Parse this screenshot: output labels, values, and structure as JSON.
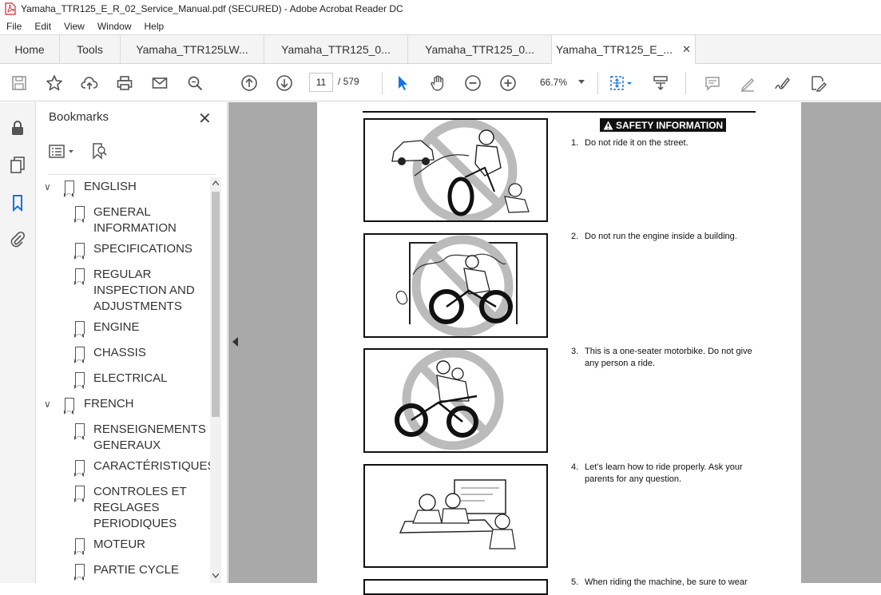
{
  "window": {
    "title": "Yamaha_TTR125_E_R_02_Service_Manual.pdf (SECURED) - Adobe Acrobat Reader DC"
  },
  "menu": [
    "File",
    "Edit",
    "View",
    "Window",
    "Help"
  ],
  "tabs": {
    "home": "Home",
    "tools": "Tools",
    "docs": [
      "Yamaha_TTR125LW...",
      "Yamaha_TTR125_0...",
      "Yamaha_TTR125_0...",
      "Yamaha_TTR125_E_..."
    ],
    "close_glyph": "✕"
  },
  "toolbar": {
    "page_current": "11",
    "page_total": "/  579",
    "zoom": "66.7%"
  },
  "bookmarks": {
    "title": "Bookmarks",
    "close_glyph": "✕",
    "items": [
      {
        "label": "ENGLISH",
        "level": 0
      },
      {
        "label": "GENERAL\nINFORMATION",
        "level": 1
      },
      {
        "label": "SPECIFICATIONS",
        "level": 1
      },
      {
        "label": "REGULAR\nINSPECTION AND\nADJUSTMENTS",
        "level": 1
      },
      {
        "label": "ENGINE",
        "level": 1
      },
      {
        "label": "CHASSIS",
        "level": 1
      },
      {
        "label": "ELECTRICAL",
        "level": 1
      },
      {
        "label": "FRENCH",
        "level": 0
      },
      {
        "label": "RENSEIGNEMENTS\nGENERAUX",
        "level": 1
      },
      {
        "label": "CARACTÉRISTIQUES",
        "level": 1
      },
      {
        "label": "CONTROLES ET\nREGLAGES\nPERIODIQUES",
        "level": 1
      },
      {
        "label": "MOTEUR",
        "level": 1
      },
      {
        "label": "PARTIE CYCLE",
        "level": 1
      }
    ]
  },
  "document": {
    "header": "SAFETY INFORMATION",
    "items": [
      {
        "num": "1.",
        "text": "Do not ride it on the street."
      },
      {
        "num": "2.",
        "text": "Do not run the engine inside a building."
      },
      {
        "num": "3.",
        "text": "This is a one-seater motorbike. Do not give any person a ride."
      },
      {
        "num": "4.",
        "text": "Let’s learn how to ride properly. Ask your parents for any question."
      },
      {
        "num": "5.",
        "text": "When riding the machine, be sure to wear"
      }
    ]
  }
}
